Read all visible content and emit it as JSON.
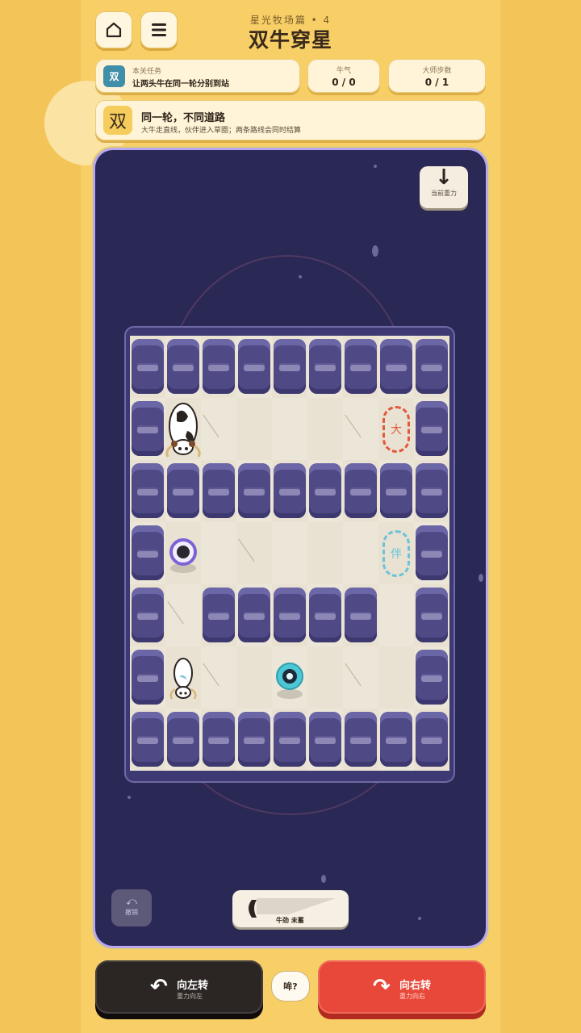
{
  "header": {
    "home_icon": "home-icon",
    "menu_icon": "menu-icon",
    "subtitle": "星光牧场篇 • 4",
    "title": "双牛穿星"
  },
  "task": {
    "badge": "双",
    "label": "本关任务",
    "text": "让两头牛在同一轮分别到站"
  },
  "stats": {
    "energy_label": "牛气",
    "energy_value": "0 / 0",
    "master_label": "大师步数",
    "master_value": "0 / 1"
  },
  "hint": {
    "badge": "双",
    "title": "同一轮，不同道路",
    "text": "大牛走直线，伙伴进入草圈；两条路线会同时结算"
  },
  "board": {
    "gravity_label": "当前重力",
    "gravity_arrow": "↓",
    "big_goal_label": "大",
    "partner_goal_label": "伴",
    "undo_arrow": "⤺",
    "undo_label": "撤销",
    "power_label": "牛劲 未蓄"
  },
  "controls": {
    "left_label": "向左转",
    "left_sub": "重力向左",
    "left_arrow": "↶",
    "bubble": "哞?",
    "right_label": "向右转",
    "right_sub": "重力向右",
    "right_arrow": "↷",
    "left_color": "#2b2623",
    "right_color": "#e8483a"
  }
}
